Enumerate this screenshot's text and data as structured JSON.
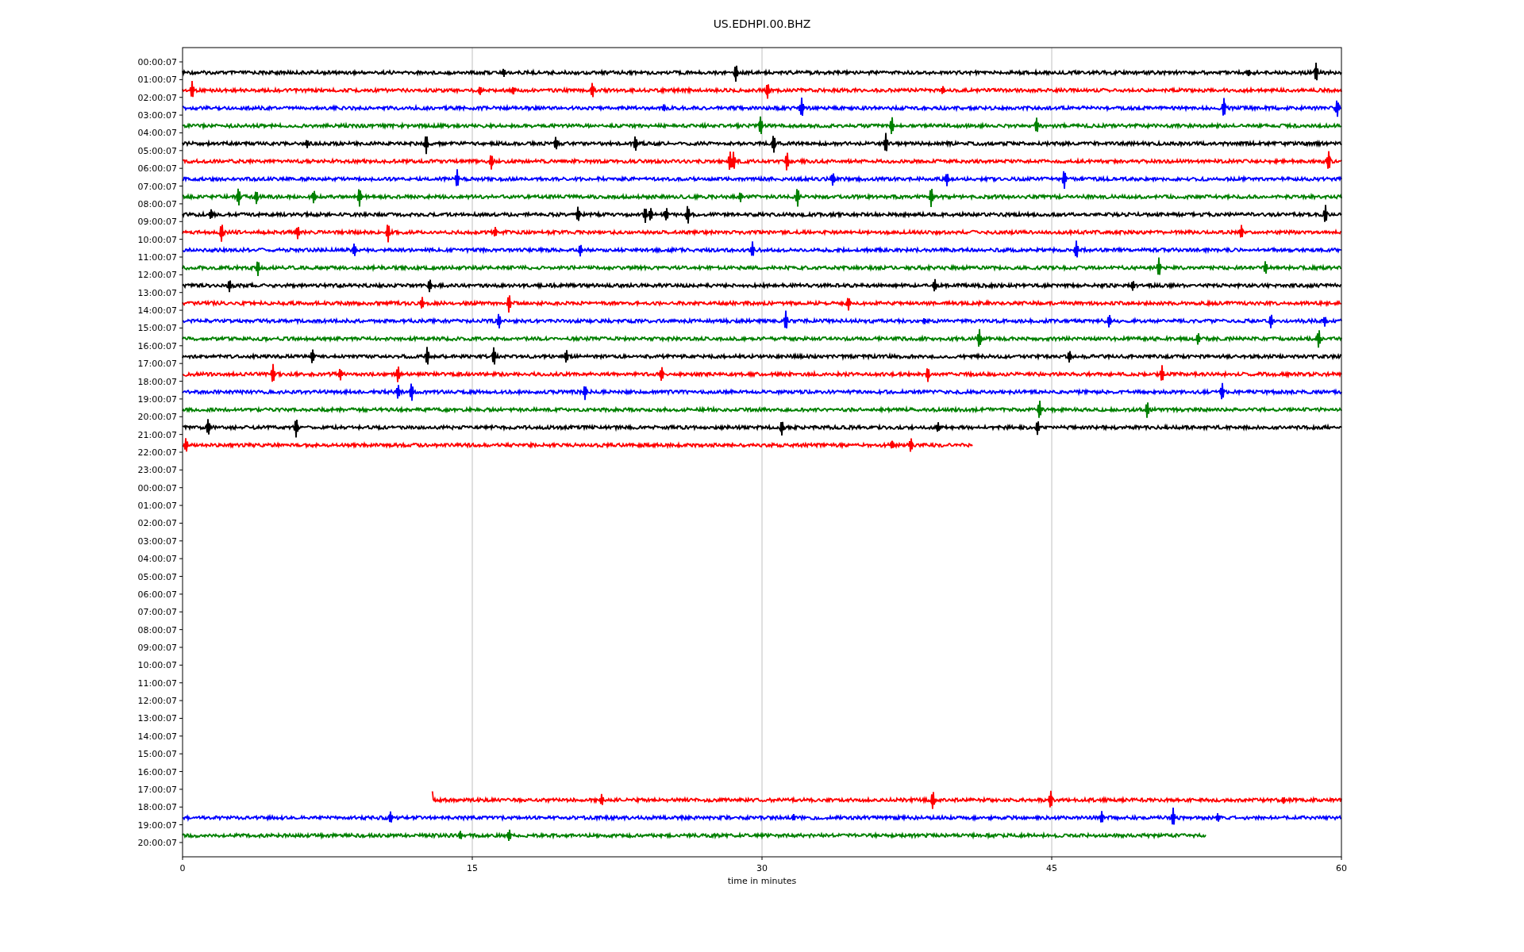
{
  "plot": {
    "title": "US.EDHPI.00.BHZ",
    "x_label": "time in minutes",
    "x_ticks": [
      "0",
      "15",
      "30",
      "45",
      "60"
    ],
    "rows": [
      {
        "label": "00:00:07",
        "trace": {
          "color": "#000000",
          "kind": "full",
          "level": 1
        }
      },
      {
        "label": "01:00:07",
        "trace": {
          "color": "#ff0000",
          "kind": "full",
          "level": 1
        }
      },
      {
        "label": "02:00:07",
        "trace": {
          "color": "#0000ff",
          "kind": "full",
          "level": 1
        }
      },
      {
        "label": "03:00:07",
        "trace": {
          "color": "#008000",
          "kind": "full",
          "level": 1
        }
      },
      {
        "label": "04:00:07",
        "trace": {
          "color": "#000000",
          "kind": "full",
          "level": 1
        }
      },
      {
        "label": "05:00:07",
        "trace": {
          "color": "#ff0000",
          "kind": "full",
          "level": 1
        }
      },
      {
        "label": "06:00:07",
        "trace": {
          "color": "#0000ff",
          "kind": "full",
          "level": 1
        }
      },
      {
        "label": "07:00:07",
        "trace": {
          "color": "#008000",
          "kind": "full",
          "level": 1
        }
      },
      {
        "label": "08:00:07",
        "trace": {
          "color": "#000000",
          "kind": "full",
          "level": 1
        }
      },
      {
        "label": "09:00:07",
        "trace": {
          "color": "#ff0000",
          "kind": "full",
          "level": 1
        }
      },
      {
        "label": "10:00:07",
        "trace": {
          "color": "#0000ff",
          "kind": "full",
          "level": 1
        }
      },
      {
        "label": "11:00:07",
        "trace": {
          "color": "#008000",
          "kind": "full",
          "level": 1
        }
      },
      {
        "label": "12:00:07",
        "trace": {
          "color": "#000000",
          "kind": "full",
          "level": 1
        }
      },
      {
        "label": "13:00:07",
        "trace": {
          "color": "#ff0000",
          "kind": "full",
          "level": 1
        }
      },
      {
        "label": "14:00:07",
        "trace": {
          "color": "#0000ff",
          "kind": "full",
          "level": 1
        }
      },
      {
        "label": "15:00:07",
        "trace": {
          "color": "#008000",
          "kind": "full",
          "level": 1
        }
      },
      {
        "label": "16:00:07",
        "trace": {
          "color": "#000000",
          "kind": "full",
          "level": 1
        }
      },
      {
        "label": "17:00:07",
        "trace": {
          "color": "#ff0000",
          "kind": "full",
          "level": 1
        }
      },
      {
        "label": "18:00:07",
        "trace": {
          "color": "#0000ff",
          "kind": "full",
          "level": 1
        }
      },
      {
        "label": "19:00:07",
        "trace": {
          "color": "#008000",
          "kind": "full",
          "level": 1
        }
      },
      {
        "label": "20:00:07",
        "trace": {
          "color": "#000000",
          "kind": "full",
          "level": 1
        }
      },
      {
        "label": "21:00:07",
        "trace": {
          "color": "#ff0000",
          "kind": "ends-early",
          "level": 0.682
        }
      },
      {
        "label": "22:00:07"
      },
      {
        "label": "23:00:07"
      },
      {
        "label": "00:00:07"
      },
      {
        "label": "01:00:07"
      },
      {
        "label": "02:00:07"
      },
      {
        "label": "03:00:07"
      },
      {
        "label": "04:00:07"
      },
      {
        "label": "05:00:07"
      },
      {
        "label": "06:00:07"
      },
      {
        "label": "07:00:07"
      },
      {
        "label": "08:00:07"
      },
      {
        "label": "09:00:07"
      },
      {
        "label": "10:00:07"
      },
      {
        "label": "11:00:07"
      },
      {
        "label": "12:00:07"
      },
      {
        "label": "13:00:07"
      },
      {
        "label": "14:00:07"
      },
      {
        "label": "15:00:07"
      },
      {
        "label": "16:00:07"
      },
      {
        "label": "17:00:07",
        "trace": {
          "color": "#ff0000",
          "kind": "starts-late",
          "level": 0.785
        }
      },
      {
        "label": "18:00:07",
        "trace": {
          "color": "#0000ff",
          "kind": "full",
          "level": 1
        }
      },
      {
        "label": "19:00:07",
        "trace": {
          "color": "#008000",
          "kind": "ends-early",
          "level": 0.883
        }
      },
      {
        "label": "20:00:07"
      }
    ]
  }
}
